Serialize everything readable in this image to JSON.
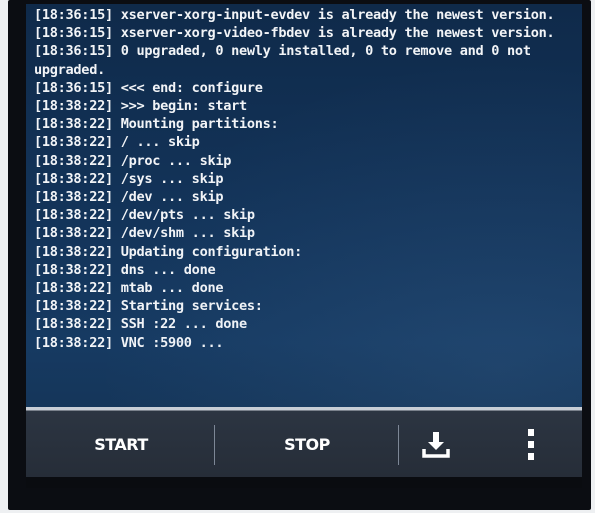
{
  "log": {
    "lines": [
      "[18:36:15] xserver-xorg-input-evdev is already the newest version.",
      "[18:36:15] xserver-xorg-video-fbdev is already the newest version.",
      "[18:36:15] 0 upgraded, 0 newly installed, 0 to remove and 0 not upgraded.",
      "[18:36:15] <<< end: configure",
      "[18:38:22] >>> begin: start",
      "[18:38:22] Mounting partitions:",
      "[18:38:22] / ... skip",
      "[18:38:22] /proc ... skip",
      "[18:38:22] /sys ... skip",
      "[18:38:22] /dev ... skip",
      "[18:38:22] /dev/pts ... skip",
      "[18:38:22] /dev/shm ... skip",
      "[18:38:22] Updating configuration:",
      "[18:38:22] dns ... done",
      "[18:38:22] mtab ... done",
      "[18:38:22] Starting services:",
      "[18:38:22] SSH :22 ... done",
      "[18:38:22] VNC :5900 ..."
    ]
  },
  "toolbar": {
    "start_label": "START",
    "stop_label": "STOP",
    "download_icon": "download-icon",
    "menu_icon": "overflow-menu-icon"
  },
  "colors": {
    "screen_background": "#13345a",
    "text": "#f2f4f7",
    "toolbar_background": "#262d38"
  }
}
